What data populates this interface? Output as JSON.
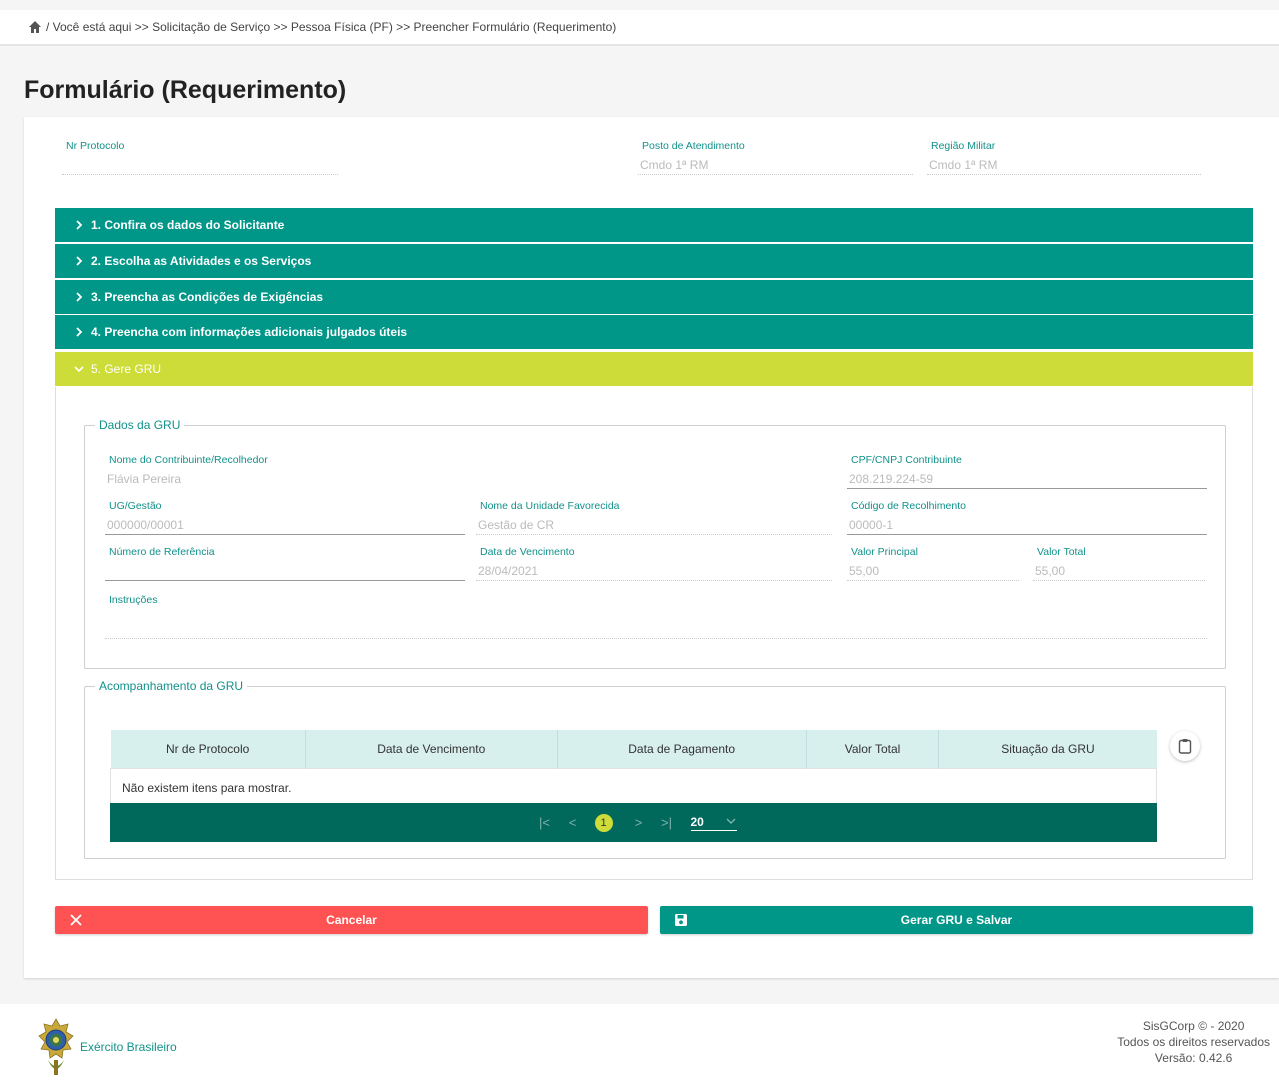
{
  "breadcrumb": {
    "text": "/ Você está aqui >> Solicitação de Serviço >> Pessoa Física (PF) >> Preencher Formulário (Requerimento)"
  },
  "page_title": "Formulário (Requerimento)",
  "header_fields": {
    "protocol": {
      "label": "Nr Protocolo",
      "value": ""
    },
    "post": {
      "label": "Posto de Atendimento",
      "value": "Cmdo 1ª RM"
    },
    "region": {
      "label": "Região Militar",
      "value": "Cmdo 1ª RM"
    }
  },
  "sections": [
    {
      "label": "1. Confira os dados do Solicitante",
      "expanded": false
    },
    {
      "label": "2. Escolha as Atividades e os Serviços",
      "expanded": false
    },
    {
      "label": "3. Preencha as Condições de Exigências",
      "expanded": false
    },
    {
      "label": "4. Preencha com informações adicionais julgados úteis",
      "expanded": false
    },
    {
      "label": "5. Gere GRU",
      "expanded": true
    }
  ],
  "gru_data": {
    "legend": "Dados da GRU",
    "contributor_name": {
      "label": "Nome do Contribuinte/Recolhedor",
      "value": "Flávia Pereira"
    },
    "cpf": {
      "label": "CPF/CNPJ Contribuinte",
      "value": "208.219.224-59"
    },
    "ug": {
      "label": "UG/Gestão",
      "value": "000000/00001"
    },
    "unit_name": {
      "label": "Nome da Unidade Favorecida",
      "value": "Gestão de CR"
    },
    "collection_code": {
      "label": "Código de Recolhimento",
      "value": "00000-1"
    },
    "reference_number": {
      "label": "Número de Referência",
      "value": ""
    },
    "due_date": {
      "label": "Data de Vencimento",
      "value": "28/04/2021"
    },
    "principal_value": {
      "label": "Valor Principal",
      "value": "55,00"
    },
    "total_value": {
      "label": "Valor Total",
      "value": "55,00"
    },
    "instructions": {
      "label": "Instruções",
      "value": ""
    }
  },
  "tracking": {
    "legend": "Acompanhamento da GRU",
    "columns": [
      "Nr de Protocolo",
      "Data de Vencimento",
      "Data de Pagamento",
      "Valor Total",
      "Situação da GRU"
    ],
    "empty_message": "Não existem itens para mostrar.",
    "pager": {
      "current_page": "1",
      "page_size": "20"
    }
  },
  "actions": {
    "cancel": "Cancelar",
    "save": "Gerar GRU e Salvar"
  },
  "footer": {
    "org": "Exército Brasileiro",
    "copyright": "SisGCorp © - 2020",
    "rights": "Todos os direitos reservados",
    "version": "Versão: 0.42.6"
  },
  "colors": {
    "teal": "#009688",
    "lime": "#cddc39",
    "dark_teal": "#00695c",
    "danger": "#ff5252"
  }
}
